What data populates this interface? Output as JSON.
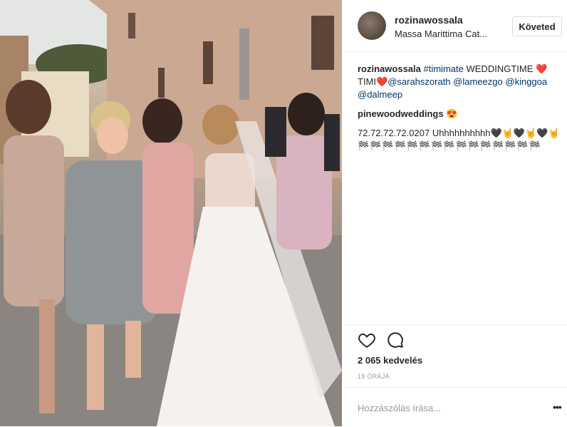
{
  "post": {
    "username": "rozinawossala",
    "location": "Massa Marittima Cat...",
    "follow_label": "Követed"
  },
  "caption": {
    "author": "rozinawossala",
    "hashtag": "#timimate",
    "text1": "WEDDINGTIME ❤️",
    "text2": "TIMI❤️",
    "mentions": [
      "@sarahszorath",
      "@lameezgo",
      "@kinggoa",
      "@dalmeep"
    ]
  },
  "comment": {
    "author": "pinewoodweddings",
    "emoji": "😍"
  },
  "comment2": {
    "text": "72.72.72.72.0207 Uhhhhhhhhhh🖤🤘🖤🤘🖤🤘",
    "flags": "🏁🏁🏁🏁🏁🏁🏁🏁🏁🏁🏁🏁🏁🏁🏁"
  },
  "stats": {
    "likes": "2 065 kedvelés",
    "time": "19 ÓRÁJA"
  },
  "add_comment": {
    "placeholder": "Hozzászólás írása...",
    "more": "•••"
  },
  "icons": {
    "like": "heart-icon",
    "comment": "comment-icon",
    "more": "more-icon"
  }
}
